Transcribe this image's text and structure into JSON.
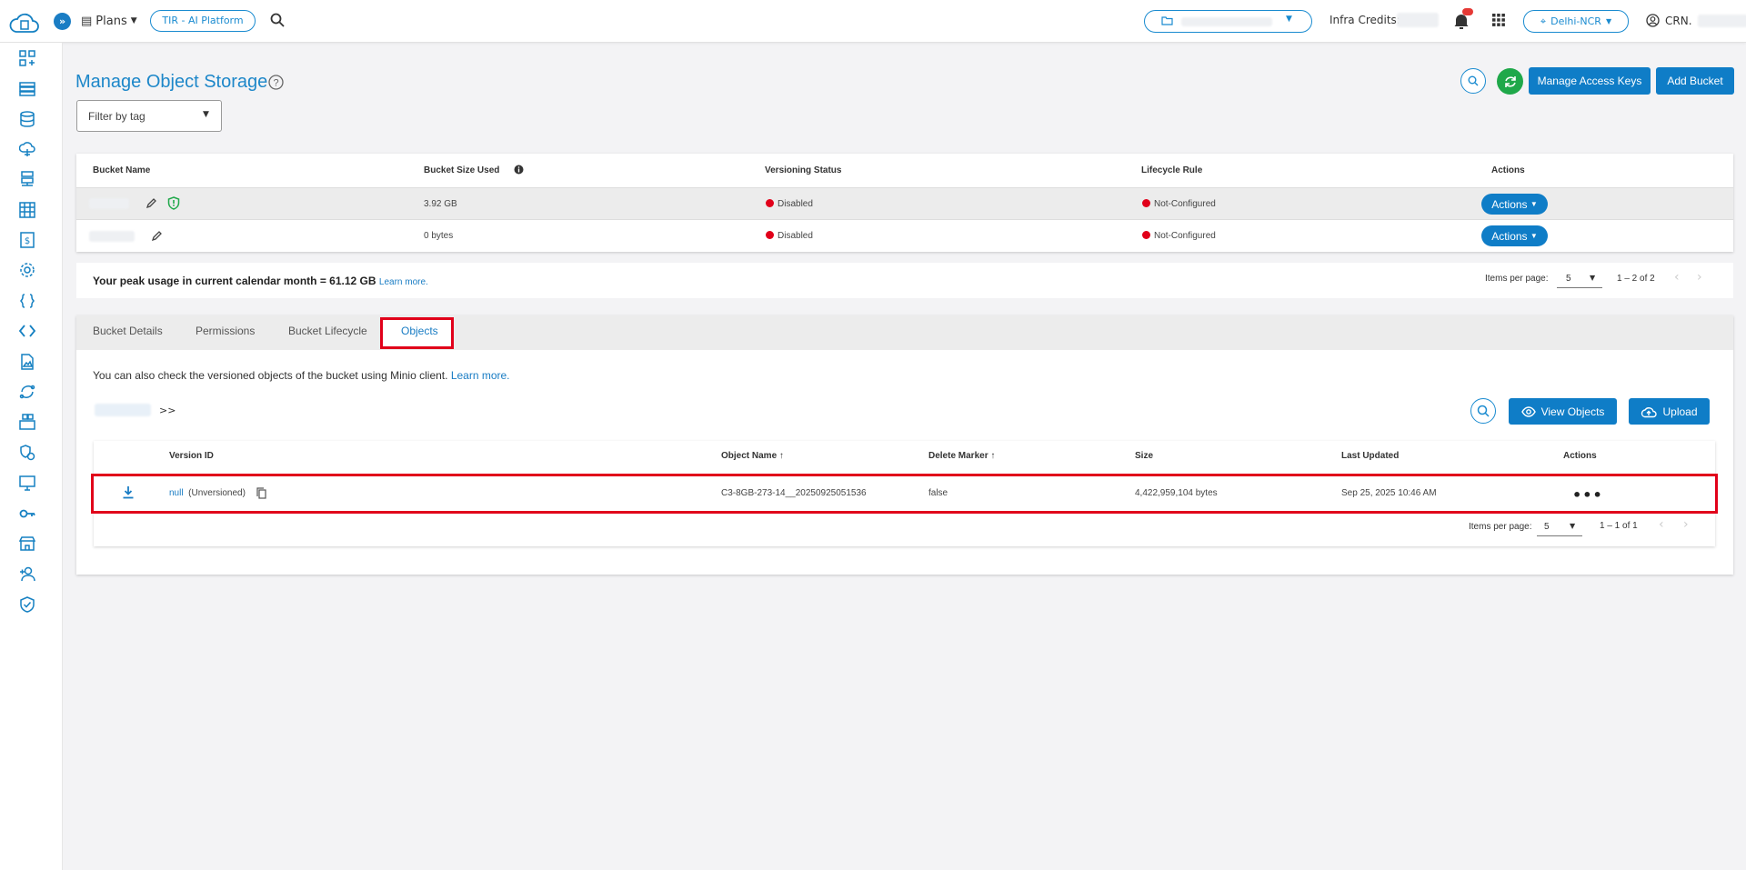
{
  "header": {
    "plans_label": "Plans",
    "platform_label": "TIR - AI Platform",
    "infra_credits_label": "Infra Credits:",
    "region_label": "Delhi-NCR",
    "account_label": "CRN."
  },
  "page": {
    "title": "Manage Object Storage",
    "filter_placeholder": "Filter by tag",
    "manage_keys_label": "Manage Access Keys",
    "add_bucket_label": "Add Bucket"
  },
  "buckets": {
    "columns": [
      "Bucket Name",
      "Bucket Size Used",
      "Versioning Status",
      "Lifecycle Rule",
      "Actions"
    ],
    "rows": [
      {
        "size": "3.92 GB",
        "versioning": "Disabled",
        "lifecycle": "Not-Configured",
        "action": "Actions"
      },
      {
        "size": "0 bytes",
        "versioning": "Disabled",
        "lifecycle": "Not-Configured",
        "action": "Actions"
      }
    ],
    "peak_usage": "Your peak usage in current calendar month = 61.12 GB",
    "learn_more": "Learn more.",
    "items_per_page_label": "Items per page:",
    "items_per_page": "5",
    "range": "1 – 2 of 2"
  },
  "tabs": [
    "Bucket Details",
    "Permissions",
    "Bucket Lifecycle",
    "Objects"
  ],
  "objects": {
    "info_text": "You can also check the versioned objects of the bucket using Minio client.",
    "learn_more": "Learn more.",
    "breadcrumb_sep": ">>",
    "view_objects_label": "View Objects",
    "upload_label": "Upload",
    "columns": [
      "Version ID",
      "Object Name",
      "Delete Marker",
      "Size",
      "Last Updated",
      "Actions"
    ],
    "rows": [
      {
        "version_id": "null",
        "version_note": "(Unversioned)",
        "object_name": "C3-8GB-273-14__20250925051536",
        "delete_marker": "false",
        "size": "4,422,959,104 bytes",
        "last_updated": "Sep 25, 2025 10:46 AM"
      }
    ],
    "items_per_page_label": "Items per page:",
    "items_per_page": "5",
    "range": "1 – 1 of 1"
  },
  "colors": {
    "primary": "#0f7dc7",
    "accent": "#1d87c9",
    "danger": "#e1001a",
    "success": "#1fa84a"
  }
}
